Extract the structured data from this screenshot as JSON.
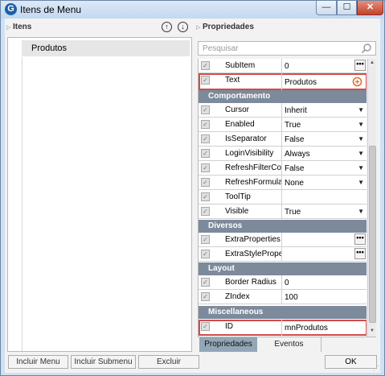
{
  "window": {
    "title": "Itens de Menu",
    "app_icon_letter": "G",
    "minimize_glyph": "—",
    "maximize_glyph": "☐",
    "close_glyph": "✕"
  },
  "left_panel": {
    "title": "Itens",
    "move_up_glyph": "↑",
    "move_down_glyph": "↓",
    "tree_items": [
      "Produtos"
    ]
  },
  "right_panel": {
    "title": "Propriedades",
    "search_placeholder": "Pesquisar",
    "rows": {
      "subitem": {
        "label": "SubItem",
        "value": "0"
      },
      "text": {
        "label": "Text",
        "value": "Produtos"
      },
      "cursor": {
        "label": "Cursor",
        "value": "Inherit"
      },
      "enabled": {
        "label": "Enabled",
        "value": "True"
      },
      "isseparator": {
        "label": "IsSeparator",
        "value": "False"
      },
      "loginvisibility": {
        "label": "LoginVisibility",
        "value": "Always"
      },
      "refreshfiltercom": {
        "label": "RefreshFilterCom",
        "value": "False"
      },
      "refreshformulas": {
        "label": "RefreshFormulas",
        "value": "None"
      },
      "tooltip": {
        "label": "ToolTip",
        "value": ""
      },
      "visible": {
        "label": "Visible",
        "value": "True"
      },
      "extraproperties": {
        "label": "ExtraProperties",
        "value": ""
      },
      "extrastyleproper": {
        "label": "ExtraStyleProper",
        "value": ""
      },
      "borderradius": {
        "label": "Border Radius",
        "value": "0"
      },
      "zindex": {
        "label": "ZIndex",
        "value": "100"
      },
      "id": {
        "label": "ID",
        "value": "mnProdutos"
      }
    },
    "categories": {
      "comportamento": "Comportamento",
      "diversos": "Diversos",
      "layout": "Layout",
      "miscellaneous": "Miscellaneous"
    },
    "tabs": [
      "Propriedades",
      "Eventos"
    ],
    "active_tab": "Propriedades"
  },
  "buttons": {
    "incluir_menu": "Incluir Menu",
    "incluir_submenu": "Incluir Submenu",
    "excluir": "Excluir",
    "ok": "OK"
  },
  "glyphs": {
    "checkbox": "✓",
    "dropdown": "▼",
    "ellipsis": "•••",
    "scroll_up": "▲",
    "scroll_down": "▼",
    "collapse": "▷",
    "resize_grip": "⋰"
  },
  "colors": {
    "category_bg": "#7c8a9b",
    "highlight_border": "#d24b4b",
    "active_tab": "#93a6b6"
  }
}
